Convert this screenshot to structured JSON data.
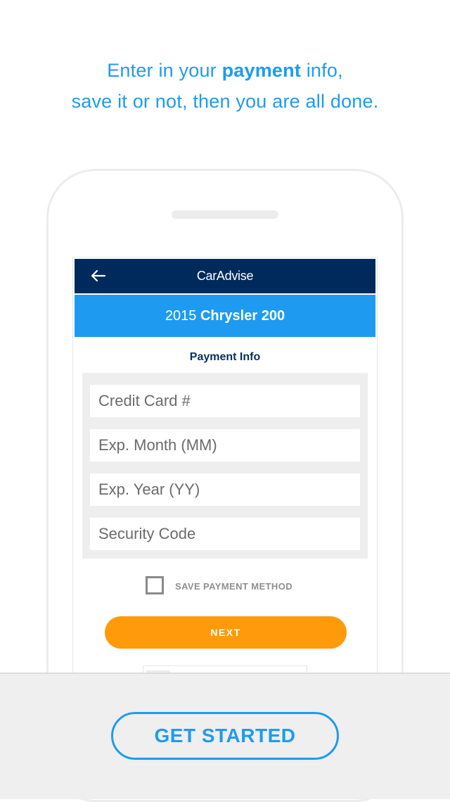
{
  "headline": {
    "line1_prefix": "Enter in your ",
    "line1_bold": "payment",
    "line1_suffix": " info,",
    "line2": "save it or not, then you are all done."
  },
  "app": {
    "brand": "CarAdvise",
    "back_icon": "arrow-left-icon",
    "vehicle": {
      "year": "2015",
      "model": "Chrysler 200"
    },
    "section_title": "Payment Info",
    "fields": [
      {
        "placeholder": "Credit Card #"
      },
      {
        "placeholder": "Exp. Month (MM)"
      },
      {
        "placeholder": "Exp. Year (YY)"
      },
      {
        "placeholder": "Security Code"
      }
    ],
    "save_payment_label": "SAVE PAYMENT METHOD",
    "save_payment_checked": false,
    "next_label": "NEXT"
  },
  "footer": {
    "cta_label": "GET STARTED"
  },
  "colors": {
    "accent_blue": "#1e9bf0",
    "navy": "#002a5c",
    "orange": "#ff9a0b"
  }
}
